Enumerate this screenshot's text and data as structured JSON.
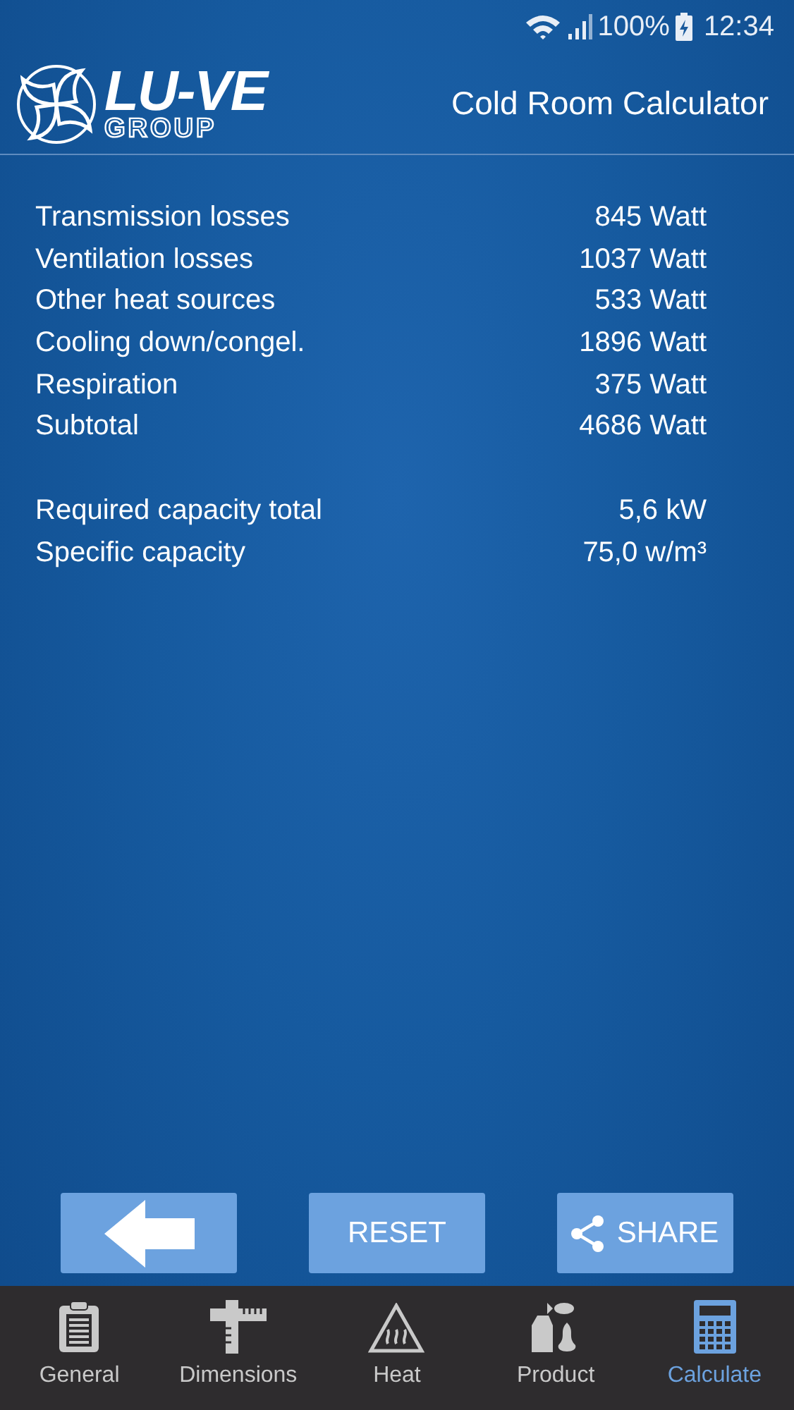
{
  "status_bar": {
    "battery": "100%",
    "time": "12:34"
  },
  "header": {
    "logo_main": "LU-VE",
    "logo_sub": "GROUP",
    "title": "Cold Room Calculator"
  },
  "results": [
    {
      "label": "Transmission losses",
      "value": "845 Watt"
    },
    {
      "label": "Ventilation losses",
      "value": "1037 Watt"
    },
    {
      "label": "Other heat sources",
      "value": "533 Watt"
    },
    {
      "label": "Cooling down/congel.",
      "value": "1896 Watt"
    },
    {
      "label": "Respiration",
      "value": "375 Watt"
    },
    {
      "label": "Subtotal",
      "value": "4686 Watt"
    }
  ],
  "totals": [
    {
      "label": "Required capacity total",
      "value": "5,6 kW"
    },
    {
      "label": "Specific capacity",
      "value": "75,0 w/m³"
    }
  ],
  "buttons": [
    {
      "kind": "back"
    },
    {
      "kind": "text",
      "label": "RESET"
    },
    {
      "kind": "share",
      "label": "SHARE"
    }
  ],
  "nav": [
    {
      "kind": "clipboard",
      "label": "General",
      "selected": false
    },
    {
      "kind": "ruler",
      "label": "Dimensions",
      "selected": false
    },
    {
      "kind": "heat",
      "label": "Heat",
      "selected": false
    },
    {
      "kind": "product",
      "label": "Product",
      "selected": false
    },
    {
      "kind": "calculator",
      "label": "Calculate",
      "selected": true
    }
  ]
}
